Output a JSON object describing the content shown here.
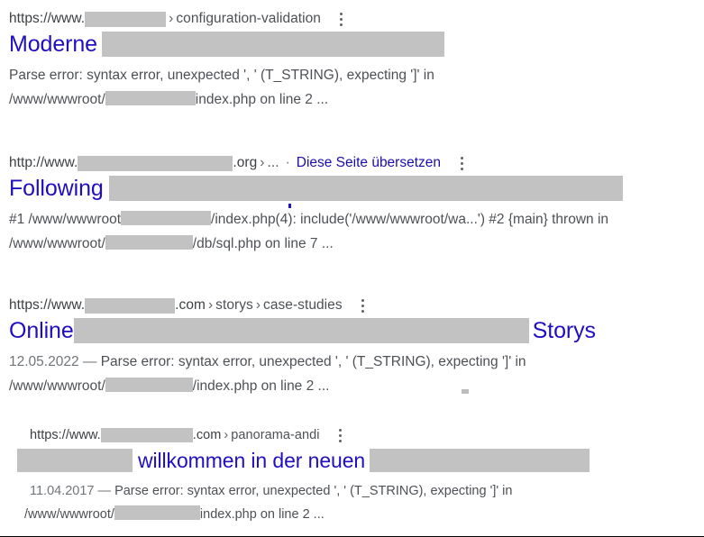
{
  "page": {
    "background": "#ffffff",
    "title_color": "#1f0fc0",
    "snippet_color": "#4d5156",
    "url_color": "#3c4043",
    "redaction_color": "#c2c2c2",
    "link_color": "#1a0dab"
  },
  "results": [
    {
      "url": {
        "scheme": "https://www.",
        "domain_redacted": true,
        "path_sep": "›",
        "path": "configuration-validation",
        "translate_label": null
      },
      "title": {
        "lead": "Moderne",
        "trail": "",
        "redacted": true
      },
      "snippet": {
        "date": "",
        "line1_pre": "Parse error: syntax error, unexpected ',  ' (T_STRING), expecting ']' in",
        "line2_pre": "/www/wwwroot/",
        "line2_post": "index.php on line 2 ..."
      },
      "menu_icon": "kebab-menu-icon"
    },
    {
      "url": {
        "scheme": "http://www.",
        "domain_redacted": true,
        "tld": ".org",
        "path_sep": "›",
        "path": "...",
        "dot": "·",
        "translate_label": "Diese Seite übersetzen"
      },
      "title": {
        "lead": "Following",
        "trail": "",
        "redacted": true
      },
      "snippet": {
        "date": "",
        "line1_pre": "#1 /www/wwwroot",
        "line1_post": "/index.php(4): include('/www/wwwroot/wa...') #2 {main} thrown in",
        "line2_pre": "/www/wwwroot/",
        "line2_post": "/db/sql.php on line 7 ..."
      },
      "menu_icon": "kebab-menu-icon"
    },
    {
      "url": {
        "scheme": "https://www.",
        "domain_redacted": true,
        "tld": ".com",
        "path_sep": "›",
        "path1": "storys",
        "path2": "case-studies",
        "translate_label": null
      },
      "title": {
        "lead": "Online",
        "trail": "Storys",
        "redacted": true
      },
      "snippet": {
        "date": "12.05.2022",
        "dash": "—",
        "line1_pre": "Parse error: syntax error, unexpected ',  ' (T_STRING), expecting ']' in",
        "line2_pre": "/www/wwwroot/",
        "line2_post": "/index.php on line 2 ..."
      },
      "menu_icon": "kebab-menu-icon"
    },
    {
      "url": {
        "scheme": "https://www.",
        "domain_redacted": true,
        "tld": ".com",
        "path_sep": "›",
        "path": "panorama-andi",
        "translate_label": null
      },
      "title": {
        "lead": "",
        "middle": "willkommen in der neuen",
        "trail": "",
        "redacted": true
      },
      "snippet": {
        "date": "11.04.2017",
        "dash": "—",
        "line1_pre": "Parse error: syntax error, unexpected ',  ' (T_STRING), expecting ']' in",
        "line2_pre": "/www/wwwroot/",
        "line2_post": "index.php on line 2 ..."
      },
      "menu_icon": "kebab-menu-icon"
    }
  ]
}
